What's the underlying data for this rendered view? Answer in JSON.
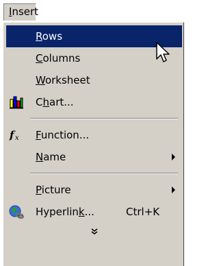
{
  "menubar": {
    "title": "Insert"
  },
  "menu": {
    "items": [
      {
        "label": "Rows",
        "mnemonic": "R",
        "highlighted": true
      },
      {
        "label": "Columns",
        "mnemonic": "C"
      },
      {
        "label": "Worksheet",
        "mnemonic": "W"
      },
      {
        "label": "Chart...",
        "mnemonic": "h",
        "icon": "chart-icon"
      },
      {
        "label": "Function...",
        "mnemonic": "F",
        "icon": "function-icon"
      },
      {
        "label": "Name",
        "mnemonic": "N",
        "submenu": true
      },
      {
        "label": "Picture",
        "mnemonic": "P",
        "submenu": true
      },
      {
        "label": "Hyperlink...",
        "mnemonic": "k",
        "shortcut": "Ctrl+K",
        "icon": "hyperlink-icon"
      }
    ],
    "expand_label": "expand-more-icon"
  },
  "colors": {
    "menu_bg": "#d4d0c8",
    "highlight_bg": "#0a246a",
    "highlight_text": "#ffffff"
  }
}
